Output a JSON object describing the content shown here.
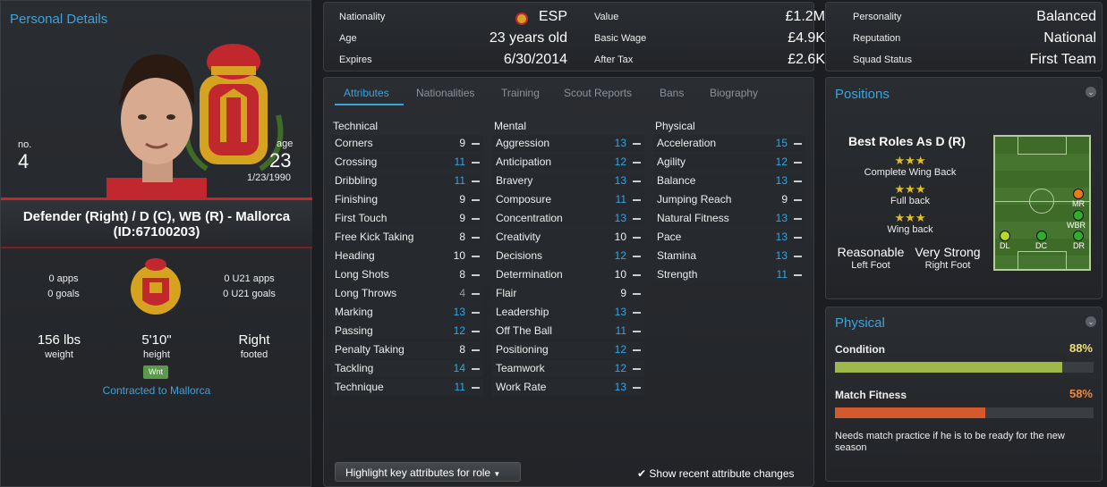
{
  "personal": {
    "title": "Personal Details",
    "no_label": "no.",
    "no_value": "4",
    "age_label": "age",
    "age_value": "23",
    "dob": "1/23/1990",
    "name_line1": "Defender (Right) / D (C), WB (R) - Mallorca",
    "name_line2": "(ID:67100203)",
    "apps": "0 apps",
    "goals": "0 goals",
    "u21_apps": "0 U21 apps",
    "u21_goals": "0 U21 goals",
    "weight_value": "156 lbs",
    "weight_label": "weight",
    "height_value": "5'10\"",
    "height_label": "height",
    "footed_value": "Right",
    "footed_label": "footed",
    "badge": "Wnt",
    "contract": "Contracted to Mallorca"
  },
  "info": {
    "nationality_label": "Nationality",
    "nationality_value": "ESP",
    "age_label": "Age",
    "age_value": "23 years old",
    "expires_label": "Expires",
    "expires_value": "6/30/2014",
    "value_label": "Value",
    "value_value": "£1.2M",
    "wage_label": "Basic Wage",
    "wage_value": "£4.9K",
    "aftertax_label": "After Tax",
    "aftertax_value": "£2.6K",
    "personality_label": "Personality",
    "personality_value": "Balanced",
    "reputation_label": "Reputation",
    "reputation_value": "National",
    "squad_label": "Squad Status",
    "squad_value": "First Team"
  },
  "tabs": [
    "Attributes",
    "Nationalities",
    "Training",
    "Scout Reports",
    "Bans",
    "Biography"
  ],
  "attributes": {
    "technical_title": "Technical",
    "mental_title": "Mental",
    "physical_title": "Physical",
    "technical": [
      [
        "Corners",
        "9"
      ],
      [
        "Crossing",
        "11"
      ],
      [
        "Dribbling",
        "11"
      ],
      [
        "Finishing",
        "9"
      ],
      [
        "First Touch",
        "9"
      ],
      [
        "Free Kick Taking",
        "8"
      ],
      [
        "Heading",
        "10"
      ],
      [
        "Long Shots",
        "8"
      ],
      [
        "Long Throws",
        "4"
      ],
      [
        "Marking",
        "13"
      ],
      [
        "Passing",
        "12"
      ],
      [
        "Penalty Taking",
        "8"
      ],
      [
        "Tackling",
        "14"
      ],
      [
        "Technique",
        "11"
      ]
    ],
    "mental": [
      [
        "Aggression",
        "13"
      ],
      [
        "Anticipation",
        "12"
      ],
      [
        "Bravery",
        "13"
      ],
      [
        "Composure",
        "11"
      ],
      [
        "Concentration",
        "13"
      ],
      [
        "Creativity",
        "10"
      ],
      [
        "Decisions",
        "12"
      ],
      [
        "Determination",
        "10"
      ],
      [
        "Flair",
        "9"
      ],
      [
        "Leadership",
        "13"
      ],
      [
        "Off The Ball",
        "11"
      ],
      [
        "Positioning",
        "12"
      ],
      [
        "Teamwork",
        "12"
      ],
      [
        "Work Rate",
        "13"
      ]
    ],
    "physical": [
      [
        "Acceleration",
        "15"
      ],
      [
        "Agility",
        "12"
      ],
      [
        "Balance",
        "13"
      ],
      [
        "Jumping Reach",
        "9"
      ],
      [
        "Natural Fitness",
        "13"
      ],
      [
        "Pace",
        "13"
      ],
      [
        "Stamina",
        "13"
      ],
      [
        "Strength",
        "11"
      ]
    ]
  },
  "highlight_button": "Highlight key attributes for role",
  "show_changes": "Show recent attribute changes",
  "positions": {
    "title": "Positions",
    "best_roles": "Best Roles As D (R)",
    "roles": [
      "Complete Wing Back",
      "Full back",
      "Wing back"
    ],
    "stars": "★★★",
    "left_foot_value": "Reasonable",
    "left_foot_label": "Left Foot",
    "right_foot_value": "Very Strong",
    "right_foot_label": "Right Foot",
    "pitch_labels": [
      "MR",
      "WBR",
      "DL",
      "DC",
      "DR"
    ]
  },
  "physical_panel": {
    "title": "Physical",
    "condition_label": "Condition",
    "condition_value": "88%",
    "condition_level": 0.88,
    "fitness_label": "Match Fitness",
    "fitness_value": "58%",
    "fitness_level": 0.58,
    "note": "Needs match practice if he is to be ready for the new season"
  },
  "colors": {
    "accent": "#39a4de",
    "condition_bar": "#9fb84a",
    "fitness_bar": "#d35a2c"
  }
}
